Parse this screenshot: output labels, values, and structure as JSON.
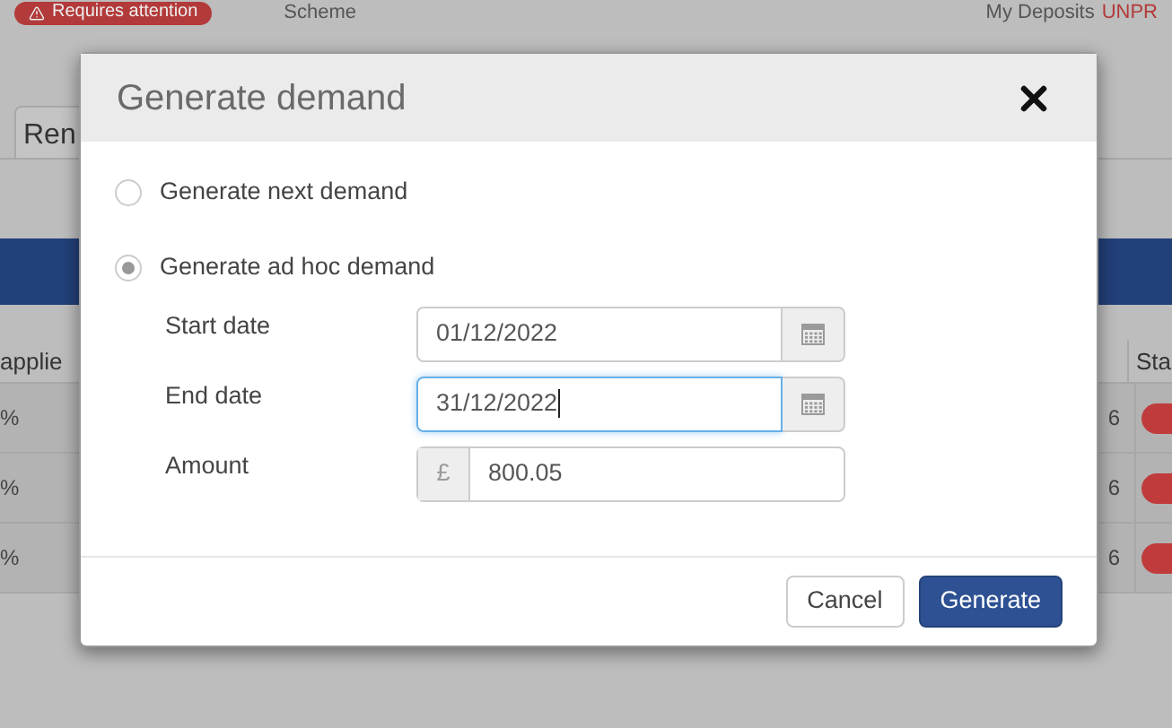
{
  "background": {
    "alert_badge": "Requires attention",
    "nav_item": "Scheme",
    "deposits_label": "My Deposits",
    "deposits_status": "UNPR",
    "tab": "Ren",
    "table": {
      "columns": [
        "applie",
        "Sta"
      ],
      "rows": [
        {
          "column_1": "%",
          "column_2": "6"
        },
        {
          "column_1": "%",
          "column_2": "6"
        },
        {
          "column_1": "%",
          "column_2": "6"
        }
      ]
    }
  },
  "dialog": {
    "title": "Generate demand",
    "options": [
      {
        "label": "Generate next demand",
        "selected": false
      },
      {
        "label": "Generate ad hoc demand",
        "selected": true
      }
    ],
    "fields": [
      {
        "kind": "date",
        "label": "Start date",
        "value": "01/12/2022",
        "focused": false
      },
      {
        "kind": "date",
        "label": "End date",
        "value": "31/12/2022",
        "focused": true
      },
      {
        "kind": "currency",
        "label": "Amount",
        "prefix": "£",
        "value": "800.05",
        "focused": false
      }
    ],
    "buttons": [
      {
        "kind": "secondary",
        "label": "Cancel"
      },
      {
        "kind": "primary",
        "label": "Generate"
      }
    ]
  }
}
